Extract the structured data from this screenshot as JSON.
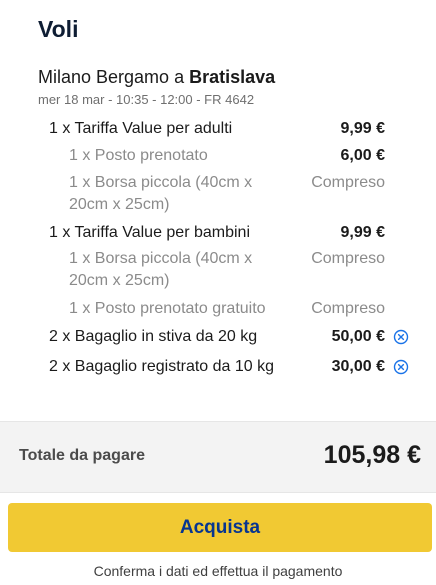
{
  "title": "Voli",
  "flight": {
    "origin_prefix": "Milano Bergamo a ",
    "destination": "Bratislava",
    "meta": "mer 18 mar  -  10:35 - 12:00  -  FR 4642"
  },
  "lines": [
    {
      "label": "1 x Tariffa Value per adulti",
      "price": "9,99 €"
    },
    {
      "label": "1 x Posto prenotato",
      "price": "6,00 €"
    },
    {
      "label": "1 x Borsa piccola (40cm x 20cm x 25cm)",
      "price": "Compreso"
    },
    {
      "label": "1 x Tariffa Value per bambini",
      "price": "9,99 €"
    },
    {
      "label": "1 x Borsa piccola (40cm x 20cm x 25cm)",
      "price": "Compreso"
    },
    {
      "label": "1 x Posto prenotato gratuito",
      "price": "Compreso"
    },
    {
      "label": "2 x Bagaglio in stiva da 20 kg",
      "price": "50,00 €"
    },
    {
      "label": "2 x Bagaglio registrato da 10 kg",
      "price": "30,00 €"
    }
  ],
  "total": {
    "label": "Totale da pagare",
    "amount": "105,98 €"
  },
  "buy_button": "Acquista",
  "confirm_note": "Conferma i dati ed effettua il pagamento",
  "colors": {
    "accent_yellow": "#f1c933",
    "button_text": "#073590",
    "remove_icon": "#1a73e8"
  }
}
